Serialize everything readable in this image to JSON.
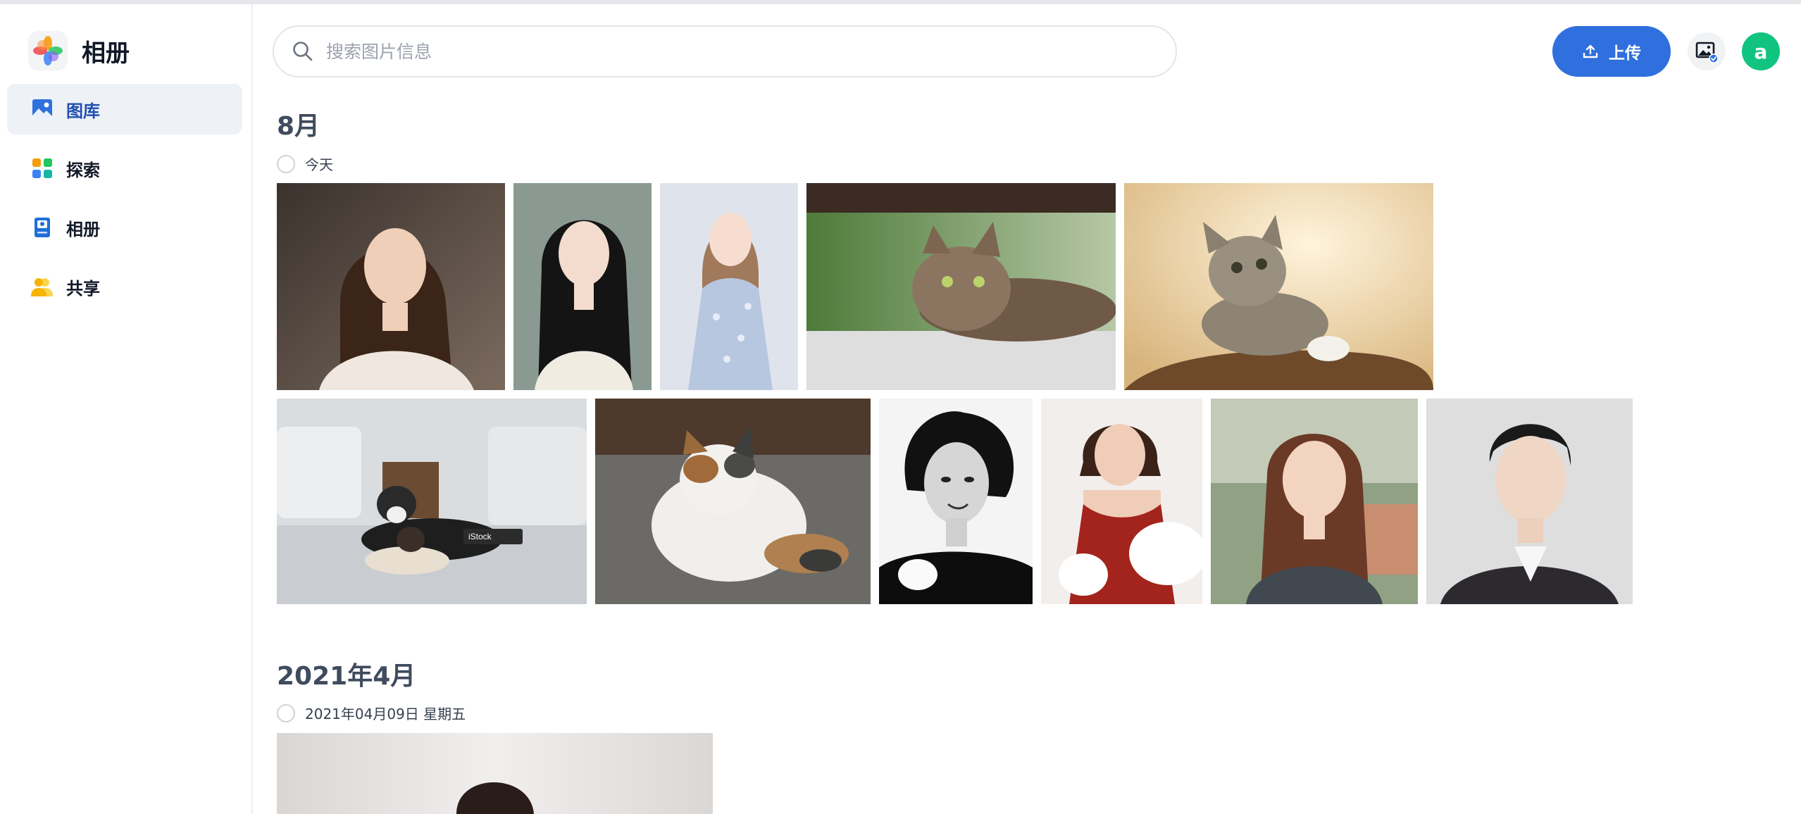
{
  "app": {
    "title": "相册"
  },
  "nav": [
    {
      "label": "图库",
      "active": true,
      "icon": "gallery-icon"
    },
    {
      "label": "探索",
      "active": false,
      "icon": "explore-icon"
    },
    {
      "label": "相册",
      "active": false,
      "icon": "album-icon"
    },
    {
      "label": "共享",
      "active": false,
      "icon": "share-icon"
    }
  ],
  "search": {
    "placeholder": "搜索图片信息",
    "value": ""
  },
  "toolbar": {
    "upload_label": "上传"
  },
  "user": {
    "avatar_letter": "a"
  },
  "colors": {
    "accent": "#2f6fde",
    "avatar": "#10c47f",
    "active_nav": "#1f4fb3"
  },
  "sections": [
    {
      "title": "8月",
      "date": "今天",
      "photos": [
        {
          "name": "photo-woman-long-hair-1",
          "subject": "woman"
        },
        {
          "name": "photo-woman-long-hair-2",
          "subject": "woman"
        },
        {
          "name": "photo-woman-floral-dress",
          "subject": "woman"
        },
        {
          "name": "photo-tabby-cat-under-table",
          "subject": "cat"
        },
        {
          "name": "photo-kitten-looking-up",
          "subject": "cat"
        },
        {
          "name": "photo-dog-and-cat-living-room",
          "subject": "dog-cat"
        },
        {
          "name": "photo-calico-cat",
          "subject": "cat"
        },
        {
          "name": "photo-bw-portrait-woman",
          "subject": "woman"
        },
        {
          "name": "photo-woman-red-dress",
          "subject": "woman"
        },
        {
          "name": "photo-woman-denim-jacket",
          "subject": "woman"
        },
        {
          "name": "photo-man-suit-portrait",
          "subject": "man"
        }
      ]
    },
    {
      "title": "2021年4月",
      "date": "2021年04月09日 星期五",
      "photos": [
        {
          "name": "photo-woman-portrait-2021",
          "subject": "woman"
        }
      ]
    }
  ]
}
